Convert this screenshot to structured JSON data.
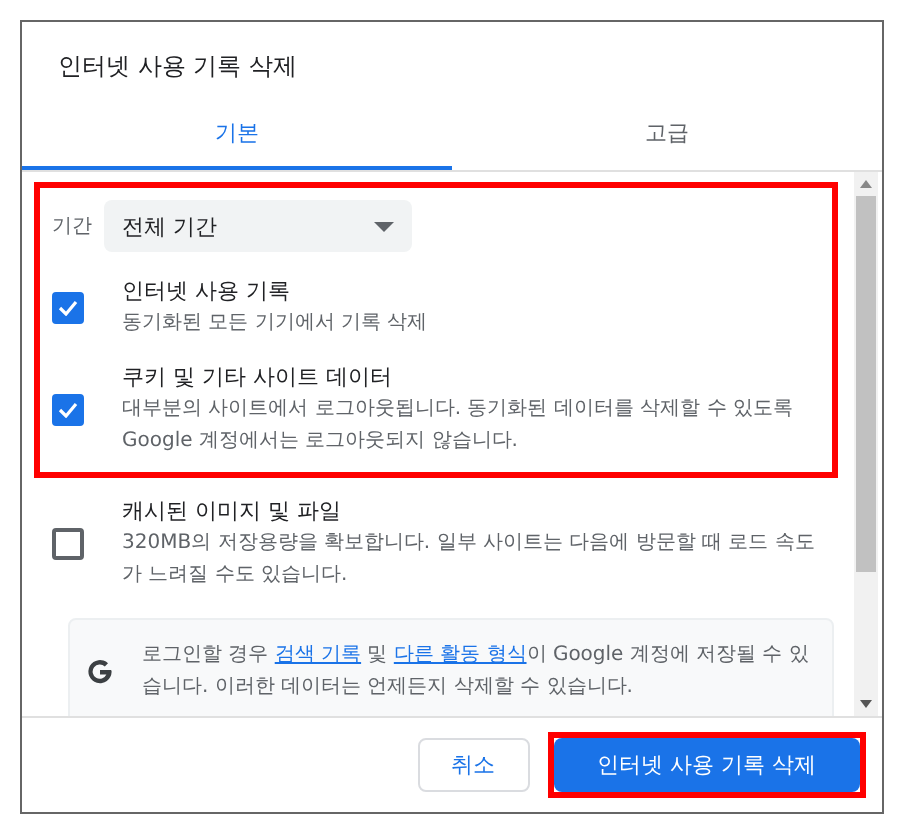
{
  "dialog": {
    "title": "인터넷 사용 기록 삭제"
  },
  "tabs": [
    {
      "label": "기본",
      "selected": true
    },
    {
      "label": "고급",
      "selected": false
    }
  ],
  "period": {
    "label": "기간",
    "value": "전체 기간",
    "highlighted": true
  },
  "options": [
    {
      "title": "인터넷 사용 기록",
      "description": "동기화된 모든 기기에서 기록 삭제",
      "checked": true,
      "highlighted": true
    },
    {
      "title": "쿠키 및 기타 사이트 데이터",
      "description": "대부분의 사이트에서 로그아웃됩니다. 동기화된 데이터를 삭제할 수 있도록 Google 계정에서는 로그아웃되지 않습니다.",
      "checked": true,
      "highlighted": true
    },
    {
      "title": "캐시된 이미지 및 파일",
      "description": "320MB의 저장용량을 확보합니다. 일부 사이트는 다음에 방문할 때 로드 속도가 느려질 수도 있습니다.",
      "checked": false,
      "highlighted": false
    }
  ],
  "info": {
    "before": "로그인할 경우",
    "link_1": "검색 기록",
    "middle": "및",
    "link_2": "다른 활동 형식",
    "after": "이 Google 계정에 저장될 수 있습니다. 이러한 데이터는 언제든지 삭제할 수 있습니다."
  },
  "buttons": [
    {
      "label": "취소",
      "kind": "secondary",
      "highlighted": false
    },
    {
      "label": "인터넷 사용 기록 삭제",
      "kind": "primary",
      "highlighted": true
    }
  ]
}
